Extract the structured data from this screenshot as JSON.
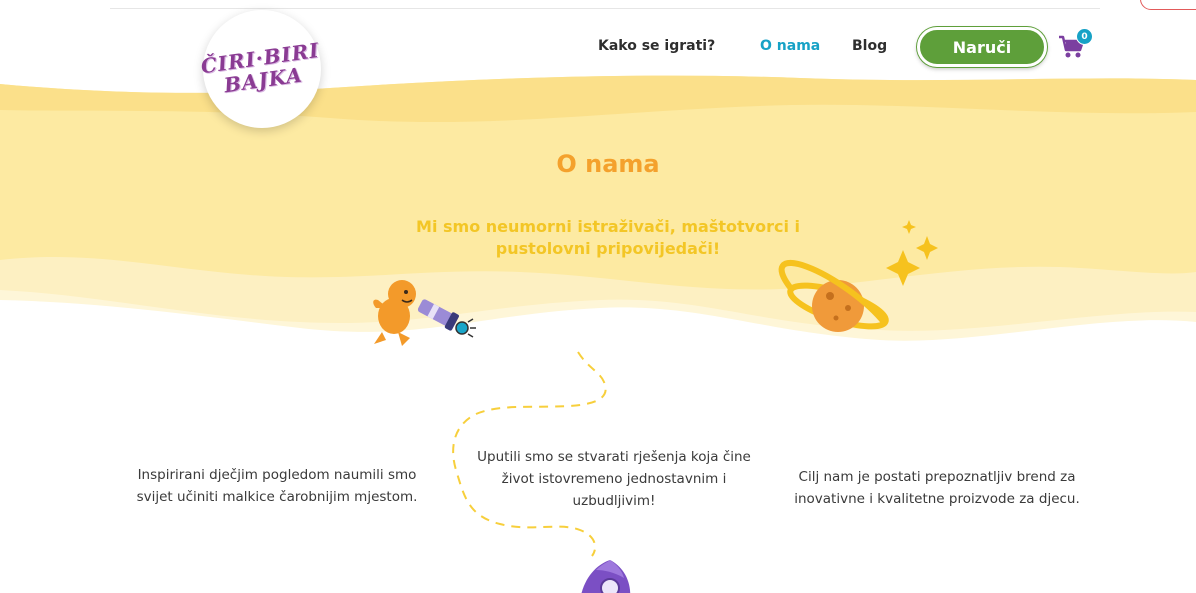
{
  "logo": {
    "line1": "ČIRI·BIRI",
    "line2": "BAJKA"
  },
  "nav": {
    "items": [
      {
        "label": "Kako se igrati?"
      },
      {
        "label": "O nama"
      },
      {
        "label": "Blog"
      }
    ],
    "order_label": "Naruči",
    "cart_count": "0"
  },
  "colors": {
    "accent_active": "#17a2c6",
    "order_button": "#5e9f3a",
    "title_orange": "#f4a12d",
    "subtitle_yellow": "#f3c626",
    "hero_yellow": "#fdeaa2"
  },
  "hero": {
    "title": "O nama",
    "subtitle": "Mi smo neumorni istraživači, maštotvorci i pustolovni pripovijedači!"
  },
  "columns": [
    {
      "text": "Inspirirani dječjim pogledom naumili smo svijet učiniti malkice čarobnijim mjestom."
    },
    {
      "text": "Uputili smo se stvarati rješenja koja čine život istovremeno jednostavnim i uzbudljivim!"
    },
    {
      "text": "Cilj nam je postati prepoznatljiv brend za inovativne i kvalitetne proizvode za djecu."
    }
  ],
  "icons": [
    "cart-icon",
    "explorer-telescope-icon",
    "planet-icon",
    "sparkle-icon",
    "rocket-icon",
    "dashed-path-icon"
  ]
}
